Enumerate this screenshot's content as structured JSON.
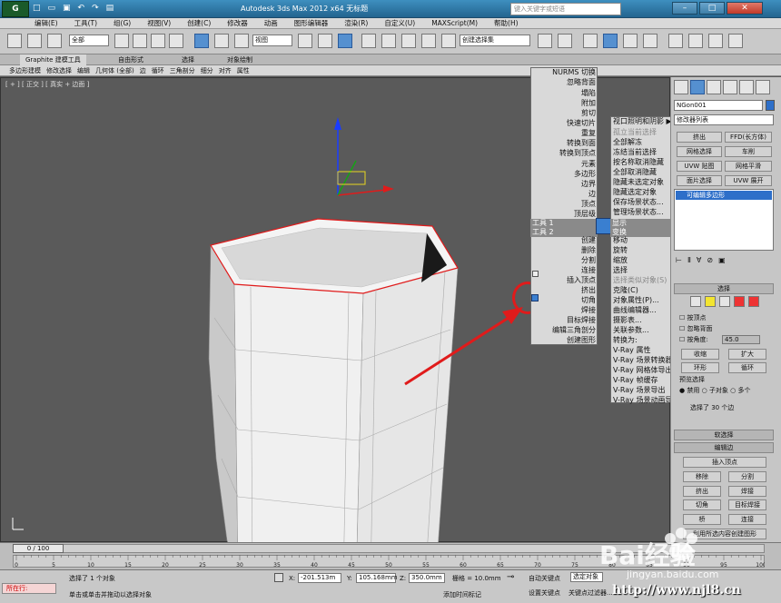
{
  "app": {
    "logo": "G",
    "title": "Autodesk 3ds Max  2012 x64",
    "doc_title": "无标题",
    "search_placeholder": "键入关键字或短语"
  },
  "qat_icons": [
    "new-icon",
    "open-icon",
    "save-icon",
    "undo-icon",
    "redo-icon",
    "open-folder-icon"
  ],
  "menubar": [
    "编辑(E)",
    "工具(T)",
    "组(G)",
    "视图(V)",
    "创建(C)",
    "修改器",
    "动画",
    "图形编辑器",
    "渲染(R)",
    "自定义(U)",
    "MAXScript(M)",
    "帮助(H)"
  ],
  "toolbar": {
    "filter": "全部",
    "ref_coord": "视图",
    "selset": "创建选择集"
  },
  "ribbon": {
    "tabs": [
      "Graphite 建模工具",
      "自由形式",
      "选择",
      "对象绘制"
    ],
    "row": [
      "多边形建模",
      "修改选择",
      "编辑",
      "几何体 (全部)",
      "边",
      "循环",
      "三角剖分",
      "细分",
      "对齐",
      "属性"
    ]
  },
  "viewport": {
    "label": "[ + ] [ 正交 ] [ 真实 + 边面 ]"
  },
  "quadmenu": {
    "left": {
      "top_items": [
        "NURMS 切换",
        "忽略背面",
        "塌陷",
        "附加",
        "剪切",
        "快速切片",
        "重复",
        "转换到面",
        "转换到顶点",
        "元素",
        "多边形",
        "边界",
        "边",
        "顶点",
        "顶层级"
      ],
      "bottom_items": [
        "创建",
        "删除",
        "分割",
        "连接",
        "插入顶点",
        "挤出",
        "切角",
        "焊接",
        "目标焊接",
        "编辑三角剖分",
        "创建图形"
      ],
      "header_left": "工具 1",
      "header_right": "工具 2"
    },
    "right": {
      "top_items": [
        "视口照明和阴影 ▶",
        "孤立当前选择",
        "全部解冻",
        "冻结当前选择",
        "按名称取消隐藏",
        "全部取消隐藏",
        "隐藏未选定对象",
        "隐藏选定对象",
        "保存场景状态...",
        "管理场景状态..."
      ],
      "header_left": "显示",
      "header_right": "变换",
      "bottom_items": [
        "移动",
        "旋转",
        "缩放",
        "选择",
        "选择类似对象(S)",
        "克隆(C)",
        "对象属性(P)...",
        "曲线编辑器...",
        "摄影表...",
        "关联参数...",
        "转换为:",
        "V-Ray 属性",
        "V-Ray 场景转换器",
        "V-Ray 网格体导出",
        "V-Ray 帧缓存",
        "V-Ray 场景导出",
        "V-Ray 场景动画导出"
      ]
    }
  },
  "cmdpanel": {
    "object_name": "NGon001",
    "modifier_list": "修改器列表",
    "buttons": [
      "挤出",
      "FFD(长方体)",
      "网格选择",
      "车削",
      "UVW 贴图",
      "网格平滑",
      "面片选择",
      "UVW 展开"
    ],
    "stack_item": "可编辑多边形",
    "selection_title": "选择",
    "by_vertex": "按顶点",
    "ignore_backface": "忽略背面",
    "by_angle": "按角度:",
    "angle_value": "45.0",
    "shrink": "收缩",
    "grow": "扩大",
    "ring": "环形",
    "loop": "循环",
    "preview_title": "预览选择",
    "preview_opts": [
      "禁用",
      "子对象",
      "多个"
    ],
    "selected_info": "选择了 30 个边",
    "soft_sel": "软选择",
    "edit_edges": "编辑边",
    "insert_vertex": "插入顶点",
    "remove": "移除",
    "split": "分割",
    "extrude": "挤出",
    "weld": "焊接",
    "chamfer": "切角",
    "target_weld": "目标焊接",
    "bridge": "桥",
    "connect": "连接",
    "create_shape": "利用所选内容创建图形"
  },
  "timeline": {
    "frame": "0 / 100",
    "ticks": [
      "0",
      "5",
      "10",
      "15",
      "20",
      "25",
      "30",
      "35",
      "40",
      "45",
      "50",
      "55",
      "60",
      "65",
      "70",
      "75",
      "80",
      "85",
      "90",
      "95",
      "100"
    ]
  },
  "status": {
    "script_label": "所在行:",
    "line1": "选择了 1 个对象",
    "line2": "单击或单击并拖动以选择对象",
    "x_label": "X:",
    "x": "-201.513m",
    "y_label": "Y:",
    "y": "105.168mm",
    "z_label": "Z:",
    "z": "350.0mm",
    "grid": "栅格 = 10.0mm",
    "autokey": "自动关键点",
    "selected": "选定对象",
    "setkey": "设置关键点",
    "keyfilter": "关键点过滤器...",
    "addtime": "添加时间标记"
  },
  "watermark": {
    "logo": "Bai经验",
    "url": "jingyan.baidu.com",
    "site": "http://www.njl8.cn"
  },
  "colors": {
    "highlight_blue": "#3a7fd0",
    "annotation_red": "#e01b1b",
    "stack_blue": "#2d6fc9"
  }
}
